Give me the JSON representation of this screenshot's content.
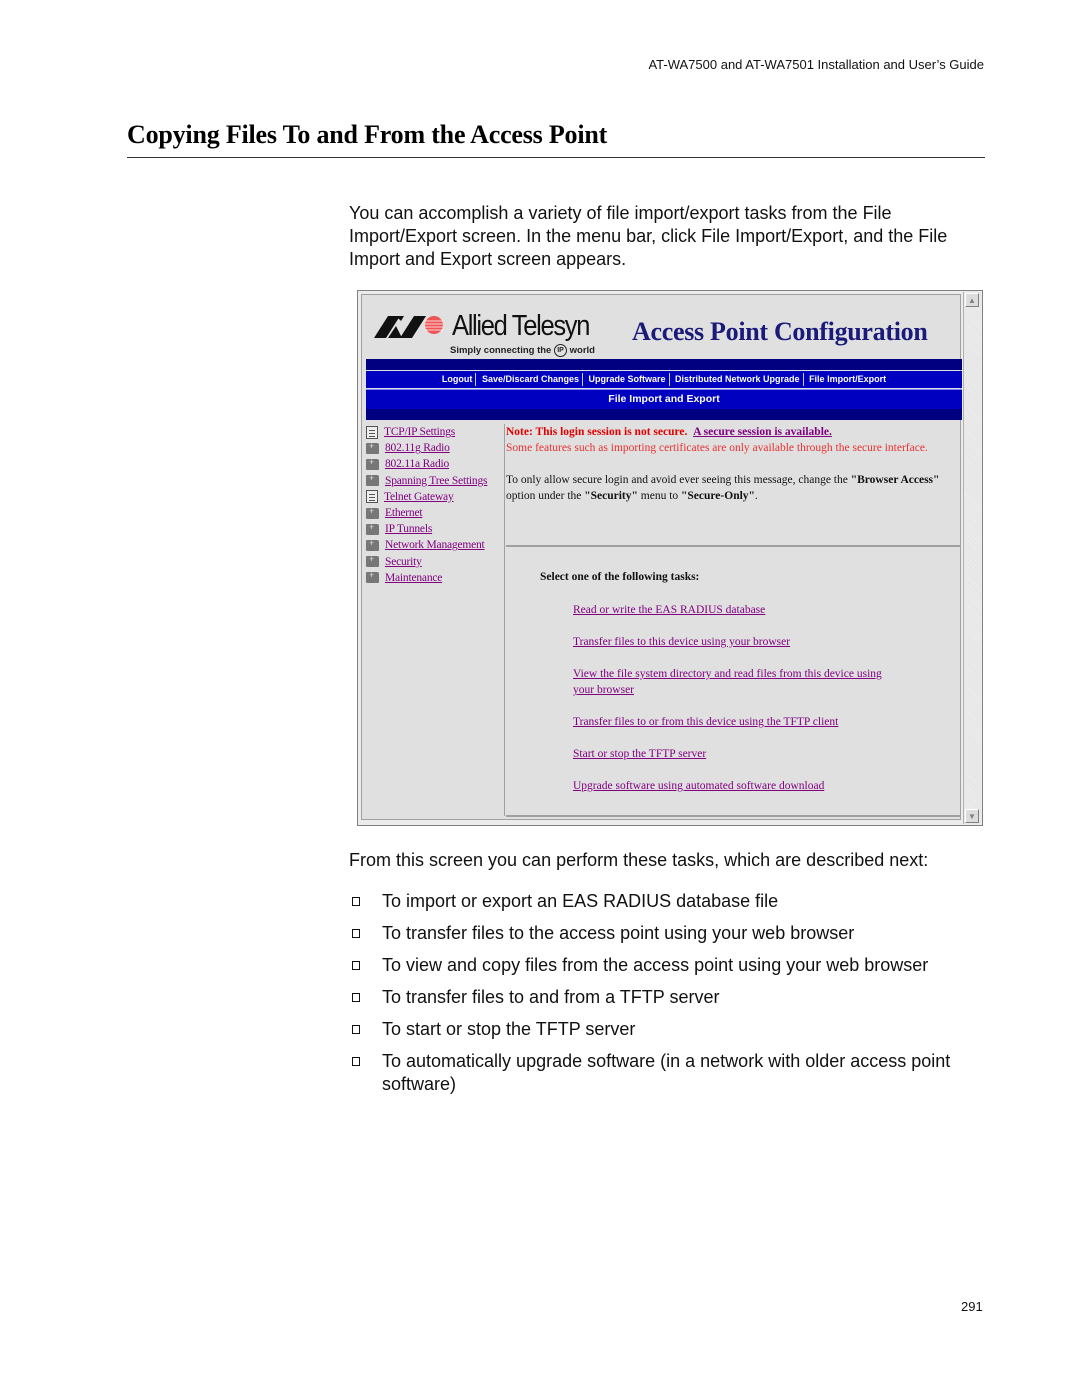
{
  "document": {
    "running_header": "AT-WA7500 and AT-WA7501 Installation and User’s Guide",
    "section_title": "Copying Files To and From the Access Point",
    "intro": "You can accomplish a variety of file import/export tasks from the File Import/Export screen. In the menu bar, click File Import/Export, and the File Import and Export screen appears.",
    "after_screenshot": "From this screen you can perform these tasks, which are described next:",
    "bullets": [
      "To import or export an EAS RADIUS database file",
      "To transfer files to the access point using your web browser",
      "To view and copy files from the access point using your web browser",
      "To transfer files to and from a TFTP server",
      "To start or stop the TFTP server",
      "To automatically upgrade software (in a network with older access point software)"
    ],
    "page_number": "291"
  },
  "screenshot": {
    "brand": {
      "name": "Allied Telesyn",
      "tagline_pre": "Simply connecting the",
      "tagline_ip": "IP",
      "tagline_post": "world"
    },
    "app_title": "Access Point Configuration",
    "nav": [
      "Logout",
      "Save/Discard Changes",
      "Upgrade Software",
      "Distributed Network Upgrade",
      "File Import/Export"
    ],
    "page_subtitle": "File Import and Export",
    "sidebar": [
      {
        "label": "TCP/IP Settings",
        "icon": "document-icon"
      },
      {
        "label": "802.11g Radio",
        "icon": "folder-icon"
      },
      {
        "label": "802.11a Radio",
        "icon": "folder-icon"
      },
      {
        "label": "Spanning Tree Settings",
        "icon": "folder-icon"
      },
      {
        "label": "Telnet Gateway",
        "icon": "document-icon"
      },
      {
        "label": "Ethernet",
        "icon": "folder-icon"
      },
      {
        "label": "IP Tunnels",
        "icon": "folder-icon"
      },
      {
        "label": "Network Management",
        "icon": "folder-icon"
      },
      {
        "label": "Security",
        "icon": "folder-icon"
      },
      {
        "label": "Maintenance",
        "icon": "folder-icon"
      }
    ],
    "note": {
      "bold": "Note: This login session is not secure.",
      "link": "A secure session is available.",
      "warning": "Some features such as importing certificates are only available through the secure interface.",
      "tip_pre": "To only allow secure login and avoid ever seeing this message, change the",
      "tip_opt": "\"Browser Access\"",
      "tip_mid": "option under the",
      "tip_menu": "\"Security\"",
      "tip_mid2": "menu to",
      "tip_val": "\"Secure-Only\"",
      "tip_end": "."
    },
    "tasks_title": "Select one of the following tasks:",
    "tasks": [
      "Read or write the EAS RADIUS database",
      "Transfer files to this device using your browser",
      "View the file system directory and read files from this device using your browser",
      "Transfer files to or from this device using the TFTP client",
      "Start or stop the TFTP server",
      "Upgrade software using automated software download"
    ],
    "colors": {
      "nav_bar": "#0000c0",
      "dark_bar": "#000080",
      "link_visited": "#800080",
      "warning": "#e00000",
      "title_navy": "#1a1a7a"
    }
  }
}
